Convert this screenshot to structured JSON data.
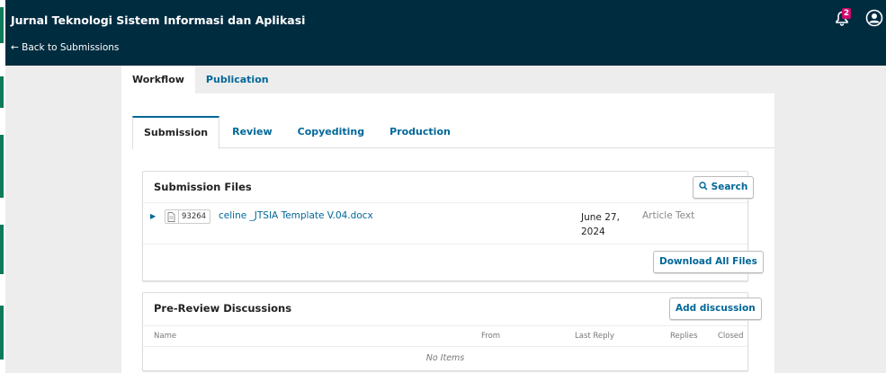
{
  "header": {
    "journal_title": "Jurnal Teknologi Sistem Informasi dan Aplikasi",
    "back_link": "← Back to Submissions",
    "notification_count": "2"
  },
  "top_tabs": [
    "Workflow",
    "Publication"
  ],
  "stage_tabs": [
    "Submission",
    "Review",
    "Copyediting",
    "Production"
  ],
  "submission_files": {
    "title": "Submission Files",
    "search_label": "Search",
    "files": [
      {
        "id": "93264",
        "name": "celine _JTSIA Template V.04.docx",
        "date": "June 27, 2024",
        "type": "Article Text"
      }
    ],
    "download_all_label": "Download All Files"
  },
  "pre_review_discussions": {
    "title": "Pre-Review Discussions",
    "add_label": "Add discussion",
    "columns": [
      "Name",
      "From",
      "Last Reply",
      "Replies",
      "Closed"
    ],
    "empty_text": "No Items"
  },
  "colors": {
    "header_bg": "#002c40",
    "link": "#006798",
    "badge": "#d00a6c",
    "side_strip": "#0e7a5a"
  }
}
